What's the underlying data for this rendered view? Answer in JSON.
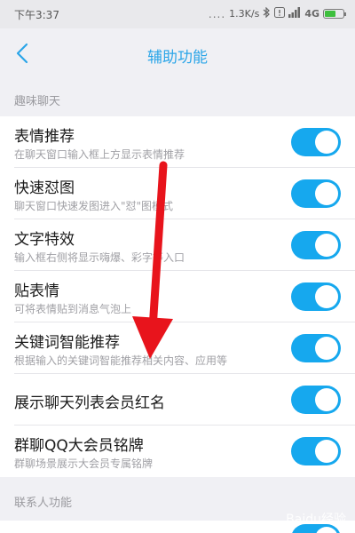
{
  "status_bar": {
    "time": "下午3:37",
    "dots": "....",
    "speed": "1.3K/s",
    "network": "4G",
    "battery_level": 0.6
  },
  "header": {
    "title": "辅助功能"
  },
  "sections": [
    {
      "title": "趣味聊天"
    },
    {
      "title": "联系人功能"
    }
  ],
  "rows": [
    {
      "title": "表情推荐",
      "desc": "在聊天窗口输入框上方显示表情推荐",
      "enabled": true
    },
    {
      "title": "快速怼图",
      "desc": "聊天窗口快速发图进入\"怼\"图模式",
      "enabled": true
    },
    {
      "title": "文字特效",
      "desc": "输入框右侧将显示嗨爆、彩字等入口",
      "enabled": true
    },
    {
      "title": "贴表情",
      "desc": "可将表情贴到消息气泡上",
      "enabled": true
    },
    {
      "title": "关键词智能推荐",
      "desc": "根据输入的关键词智能推荐相关内容、应用等",
      "enabled": true
    },
    {
      "title": "展示聊天列表会员红名",
      "enabled": true
    },
    {
      "title": "群聊QQ大会员铭牌",
      "desc": "群聊场景展示大会员专属铭牌",
      "enabled": true
    }
  ],
  "watermark": {
    "text": "Baidu经验"
  },
  "colors": {
    "accent": "#16a8ee",
    "title_blue": "#2aa5e8",
    "arrow_red": "#e8141c"
  }
}
